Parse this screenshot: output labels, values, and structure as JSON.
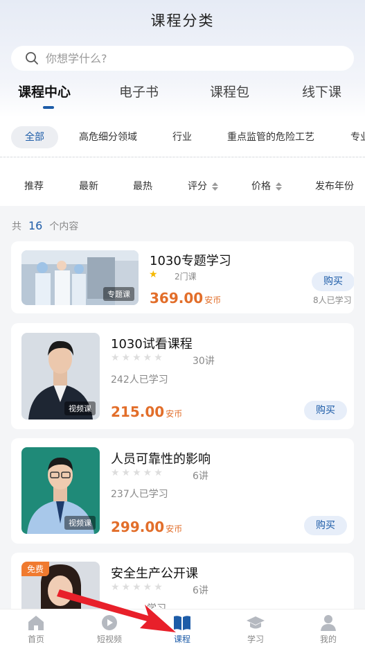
{
  "header": {
    "title": "课程分类"
  },
  "search": {
    "placeholder": "你想学什么?"
  },
  "main_tabs": [
    {
      "label": "课程中心",
      "active": true
    },
    {
      "label": "电子书"
    },
    {
      "label": "课程包"
    },
    {
      "label": "线下课"
    }
  ],
  "categories": [
    {
      "label": "全部",
      "active": true
    },
    {
      "label": "高危细分领域"
    },
    {
      "label": "行业"
    },
    {
      "label": "重点监管的危险工艺"
    },
    {
      "label": "专业"
    }
  ],
  "sort_options": [
    {
      "label": "推荐"
    },
    {
      "label": "最新"
    },
    {
      "label": "最热"
    },
    {
      "label": "评分"
    },
    {
      "label": "价格"
    },
    {
      "label": "发布年份"
    }
  ],
  "result_count": {
    "prefix": "共",
    "count": "16",
    "suffix": "个内容"
  },
  "courses": [
    {
      "title": "1030专题学习",
      "tag": "专题课",
      "rating": 1,
      "lessons": "2门课",
      "price": "369.00",
      "unit": "安币",
      "learners": "8人已学习",
      "buy": "购买"
    },
    {
      "title": "1030试看课程",
      "tag": "视频课",
      "rating": 0,
      "lessons": "30讲",
      "learners": "242人已学习",
      "price": "215.00",
      "unit": "安币",
      "buy": "购买"
    },
    {
      "title": "人员可靠性的影响",
      "tag": "视频课",
      "rating": 0,
      "lessons": "6讲",
      "learners": "237人已学习",
      "price": "299.00",
      "unit": "安币",
      "buy": "购买"
    },
    {
      "title": "安全生产公开课",
      "free_tag": "免费",
      "rating": 0,
      "lessons": "6讲",
      "learners": "学习"
    }
  ],
  "bottom_nav": [
    {
      "label": "首页",
      "icon": "home-icon"
    },
    {
      "label": "短视频",
      "icon": "play-icon"
    },
    {
      "label": "课程",
      "icon": "book-icon",
      "active": true
    },
    {
      "label": "学习",
      "icon": "graduation-cap-icon"
    },
    {
      "label": "我的",
      "icon": "user-icon"
    }
  ],
  "colors": {
    "accent": "#1d5ca8",
    "price": "#e26e2a",
    "arrow": "#e8202a"
  }
}
